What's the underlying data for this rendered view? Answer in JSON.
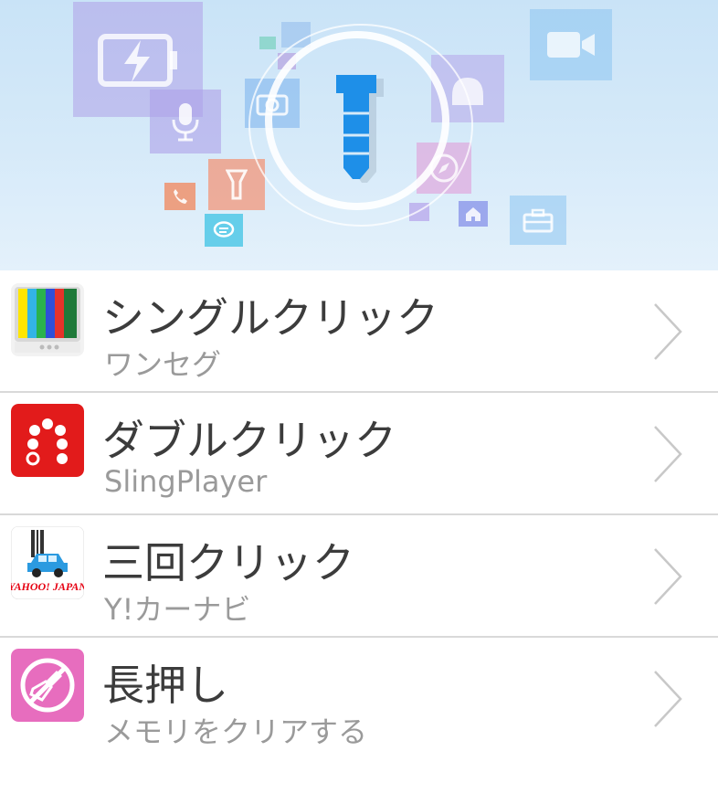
{
  "header": {
    "hero_icon": "earphone-jack-plug-icon",
    "background_icons": [
      "battery-charging-icon",
      "microphone-icon",
      "camera-icon",
      "flashlight-icon",
      "phone-icon",
      "chat-icon",
      "android-icon",
      "compass-icon",
      "home-icon",
      "toolbox-icon",
      "video-camera-icon"
    ]
  },
  "actions": [
    {
      "title": "シングルクリック",
      "subtitle": "ワンセグ",
      "icon": "tv-color-bars-icon"
    },
    {
      "title": "ダブルクリック",
      "subtitle": "SlingPlayer",
      "icon": "slingplayer-icon"
    },
    {
      "title": "三回クリック",
      "subtitle": "Y!カーナビ",
      "icon": "yahoo-car-navi-icon",
      "icon_text": "YAHOO! JAPAN"
    },
    {
      "title": "長押し",
      "subtitle": "メモリをクリアする",
      "icon": "memory-cleaner-brush-icon"
    }
  ],
  "colors": {
    "accent_blue": "#1e8fe8",
    "slingplayer_red": "#e21b1b",
    "cleaner_pink": "#e76dbe",
    "divider": "#d9d9d9",
    "title_text": "#3c3c3c",
    "subtitle_text": "#9a9a9a"
  }
}
